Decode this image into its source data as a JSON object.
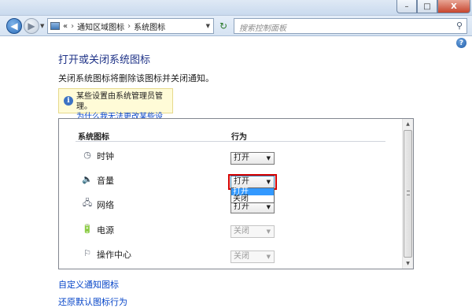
{
  "window": {
    "minimize": "–",
    "maximize": "□",
    "close": "X"
  },
  "nav": {
    "back_icon": "back-arrow",
    "forward_icon": "forward-arrow",
    "breadcrumb_overflow": "«",
    "breadcrumb": [
      "通知区域图标",
      "系统图标"
    ],
    "search_placeholder": "搜索控制面板"
  },
  "page": {
    "title": "打开或关闭系统图标",
    "description": "关闭系统图标将删除该图标并关闭通知。",
    "info": {
      "text": "某些设置由系统管理员管理。",
      "link": "为什么我无法更改某些设置?"
    },
    "table": {
      "col_icon": "系统图标",
      "col_behavior": "行为",
      "rows": [
        {
          "icon": "clock-icon",
          "label": "时钟",
          "value": "打开",
          "enabled": true
        },
        {
          "icon": "volume-icon",
          "label": "音量",
          "value": "打开",
          "enabled": true
        },
        {
          "icon": "network-icon",
          "label": "网络",
          "value": "打开",
          "enabled": true
        },
        {
          "icon": "power-icon",
          "label": "电源",
          "value": "关闭",
          "enabled": false
        },
        {
          "icon": "action-center-icon",
          "label": "操作中心",
          "value": "关闭",
          "enabled": false
        }
      ]
    },
    "dropdown_open": {
      "options": [
        "打开",
        "关闭"
      ],
      "highlighted": "打开"
    },
    "links": [
      "自定义通知图标",
      "还原默认图标行为"
    ]
  }
}
